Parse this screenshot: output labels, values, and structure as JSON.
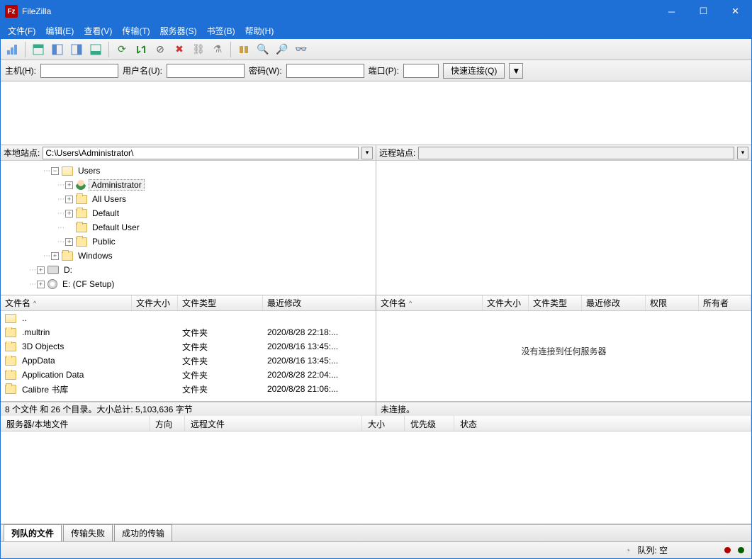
{
  "title": "FileZilla",
  "menu": [
    "文件(F)",
    "编辑(E)",
    "查看(V)",
    "传输(T)",
    "服务器(S)",
    "书签(B)",
    "帮助(H)"
  ],
  "quick": {
    "host": "主机(H):",
    "user": "用户名(U):",
    "pass": "密码(W):",
    "port": "端口(P):",
    "btn": "快速连接(Q)"
  },
  "local": {
    "label": "本地站点:",
    "path": "C:\\Users\\Administrator\\",
    "tree": [
      {
        "ind": 60,
        "exp": "-",
        "icon": "fopen",
        "label": "Users"
      },
      {
        "ind": 80,
        "exp": "+",
        "icon": "user",
        "label": "Administrator",
        "sel": true
      },
      {
        "ind": 80,
        "exp": "+",
        "icon": "folder",
        "label": "All Users"
      },
      {
        "ind": 80,
        "exp": "+",
        "icon": "folder",
        "label": "Default"
      },
      {
        "ind": 80,
        "exp": "",
        "icon": "folder",
        "label": "Default User"
      },
      {
        "ind": 80,
        "exp": "+",
        "icon": "folder",
        "label": "Public"
      },
      {
        "ind": 60,
        "exp": "+",
        "icon": "folder",
        "label": "Windows"
      },
      {
        "ind": 40,
        "exp": "+",
        "icon": "drive",
        "label": "D:"
      },
      {
        "ind": 40,
        "exp": "+",
        "icon": "cd",
        "label": "E: (CF Setup)"
      }
    ],
    "cols": [
      "文件名",
      "文件大小",
      "文件类型",
      "最近修改"
    ],
    "files": [
      {
        "name": "..",
        "type": "",
        "date": ""
      },
      {
        "name": ".multrin",
        "type": "文件夹",
        "date": "2020/8/28 22:18:..."
      },
      {
        "name": "3D Objects",
        "type": "文件夹",
        "date": "2020/8/16 13:45:..."
      },
      {
        "name": "AppData",
        "type": "文件夹",
        "date": "2020/8/16 13:45:..."
      },
      {
        "name": "Application Data",
        "type": "文件夹",
        "date": "2020/8/28 22:04:..."
      },
      {
        "name": "Calibre 书库",
        "type": "文件夹",
        "date": "2020/8/28 21:06:..."
      }
    ],
    "status": "8 个文件 和 26 个目录。大小总计: 5,103,636 字节"
  },
  "remote": {
    "label": "远程站点:",
    "cols": [
      "文件名",
      "文件大小",
      "文件类型",
      "最近修改",
      "权限",
      "所有者"
    ],
    "empty": "没有连接到任何服务器",
    "status": "未连接。"
  },
  "queue": {
    "cols": [
      "服务器/本地文件",
      "方向",
      "远程文件",
      "大小",
      "优先级",
      "状态"
    ]
  },
  "tabs": [
    "列队的文件",
    "传输失败",
    "成功的传输"
  ],
  "statusbar": {
    "queue": "队列: 空"
  }
}
